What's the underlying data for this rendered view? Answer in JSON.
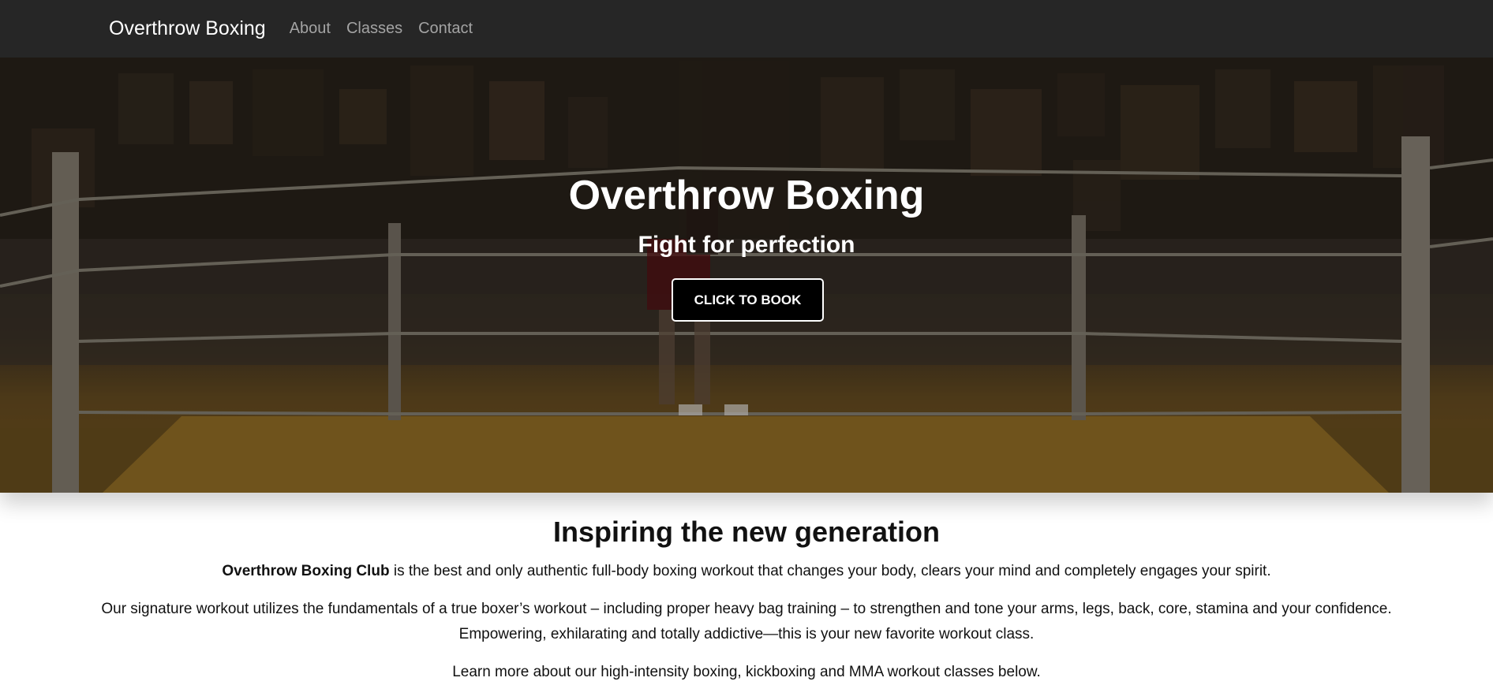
{
  "navbar": {
    "brand": "Overthrow Boxing",
    "links": [
      "About",
      "Classes",
      "Contact"
    ]
  },
  "hero": {
    "title": "Overthrow Boxing",
    "subtitle": "Fight for perfection",
    "button_label": "CLICK TO BOOK"
  },
  "intro": {
    "heading": "Inspiring the new generation",
    "p1_bold": "Overthrow Boxing Club",
    "p1_rest": " is the best and only authentic full-body boxing workout that changes your body, clears your mind and completely engages your spirit.",
    "p2": "Our signature workout utilizes the fundamentals of a true boxer’s workout – including proper heavy bag training – to strengthen and tone your arms, legs, back, core, stamina and your confidence. Empowering, exhilarating and totally addictive—this is your new favorite workout class.",
    "p3": "Learn more about our high-intensity boxing, kickboxing and MMA workout classes below."
  },
  "colors": {
    "navbar_bg": "#262626",
    "brand_text": "#ffffff",
    "nav_link": "#a3a3a3",
    "button_bg": "#000000",
    "button_border": "#ffffff"
  }
}
